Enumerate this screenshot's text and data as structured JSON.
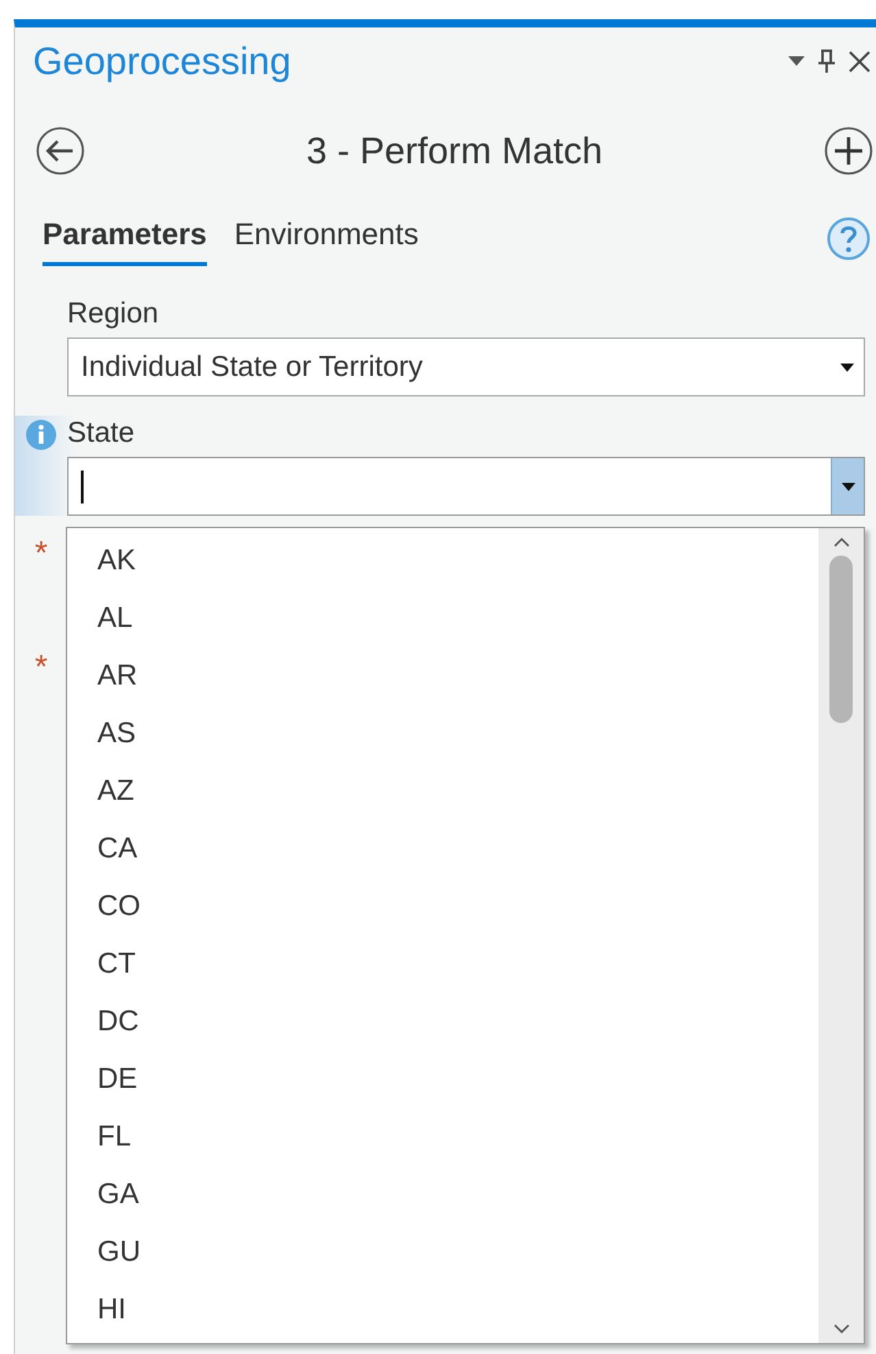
{
  "pane": {
    "title": "Geoprocessing"
  },
  "tool": {
    "title": "3 - Perform Match"
  },
  "tabs": [
    {
      "label": "Parameters",
      "selected": true
    },
    {
      "label": "Environments",
      "selected": false
    }
  ],
  "parameters": [
    {
      "label": "Region",
      "value": "Individual State or Territory",
      "focused": false,
      "info": false
    },
    {
      "label": "State",
      "focused": true,
      "info": true
    }
  ],
  "required_marks": [
    "*",
    "*"
  ],
  "dropdown": {
    "options": [
      "AK",
      "AL",
      "AR",
      "AS",
      "AZ",
      "CA",
      "CO",
      "CT",
      "DC",
      "DE",
      "FL",
      "GA",
      "GU",
      "HI"
    ]
  }
}
